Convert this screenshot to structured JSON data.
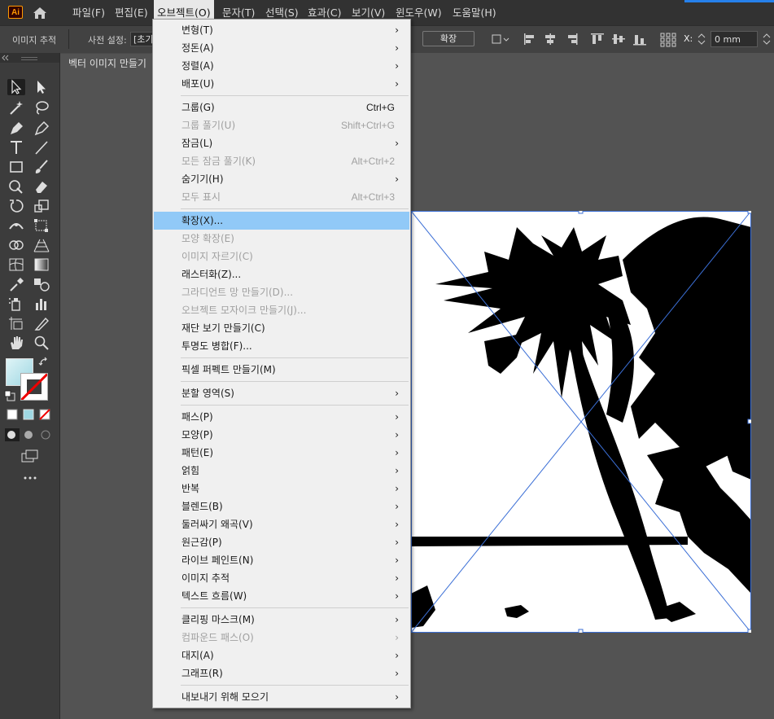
{
  "app": {
    "logo": "Ai",
    "icons": {
      "home": "home-icon"
    },
    "accent": "#ff9a00"
  },
  "menubar": {
    "items": [
      "파일(F)",
      "편집(E)",
      "오브젝트(O)",
      "문자(T)",
      "선택(S)",
      "효과(C)",
      "보기(V)",
      "윈도우(W)",
      "도움말(H)"
    ],
    "active_index": 2
  },
  "controlbar": {
    "image_trace_label": "이미지 추적",
    "preset_label": "사전 설정:",
    "preset_value": "[초기",
    "expand_button": "확장",
    "x_label": "X:",
    "x_value": "0 mm"
  },
  "document": {
    "tab_title": "벡터 이미지 만들기"
  },
  "object_menu": {
    "highlight_color": "#91c9f7",
    "groups": [
      [
        {
          "label": "변형(T)",
          "submenu": true
        },
        {
          "label": "정돈(A)",
          "submenu": true
        },
        {
          "label": "정렬(A)",
          "submenu": true
        },
        {
          "label": "배포(U)",
          "submenu": true
        }
      ],
      [
        {
          "label": "그룹(G)",
          "shortcut": "Ctrl+G"
        },
        {
          "label": "그룹 풀기(U)",
          "shortcut": "Shift+Ctrl+G",
          "disabled": true
        },
        {
          "label": "잠금(L)",
          "submenu": true
        },
        {
          "label": "모든 잠금 풀기(K)",
          "shortcut": "Alt+Ctrl+2",
          "disabled": true
        },
        {
          "label": "숨기기(H)",
          "submenu": true
        },
        {
          "label": "모두 표시",
          "shortcut": "Alt+Ctrl+3",
          "disabled": true
        }
      ],
      [
        {
          "label": "확장(X)...",
          "highlighted": true
        },
        {
          "label": "모양 확장(E)",
          "disabled": true
        },
        {
          "label": "이미지 자르기(C)",
          "disabled": true
        },
        {
          "label": "래스터화(Z)..."
        },
        {
          "label": "그라디언트 망 만들기(D)...",
          "disabled": true
        },
        {
          "label": "오브젝트 모자이크 만들기(J)...",
          "disabled": true
        },
        {
          "label": "재단 보기 만들기(C)"
        },
        {
          "label": "투명도 병합(F)..."
        }
      ],
      [
        {
          "label": "픽셀 퍼펙트 만들기(M)"
        }
      ],
      [
        {
          "label": "분할 영역(S)",
          "submenu": true
        }
      ],
      [
        {
          "label": "패스(P)",
          "submenu": true
        },
        {
          "label": "모양(P)",
          "submenu": true
        },
        {
          "label": "패턴(E)",
          "submenu": true
        },
        {
          "label": "얽힘",
          "submenu": true
        },
        {
          "label": "반복",
          "submenu": true
        },
        {
          "label": "블렌드(B)",
          "submenu": true
        },
        {
          "label": "둘러싸기 왜곡(V)",
          "submenu": true
        },
        {
          "label": "원근감(P)",
          "submenu": true
        },
        {
          "label": "라이브 페인트(N)",
          "submenu": true
        },
        {
          "label": "이미지 추적",
          "submenu": true
        },
        {
          "label": "텍스트 흐름(W)",
          "submenu": true
        }
      ],
      [
        {
          "label": "클리핑 마스크(M)",
          "submenu": true
        },
        {
          "label": "컴파운드 패스(O)",
          "submenu": true,
          "disabled": true
        },
        {
          "label": "대지(A)",
          "submenu": true
        },
        {
          "label": "그래프(R)",
          "submenu": true
        }
      ],
      [
        {
          "label": "내보내기 위해 모으기",
          "submenu": true
        }
      ]
    ]
  }
}
